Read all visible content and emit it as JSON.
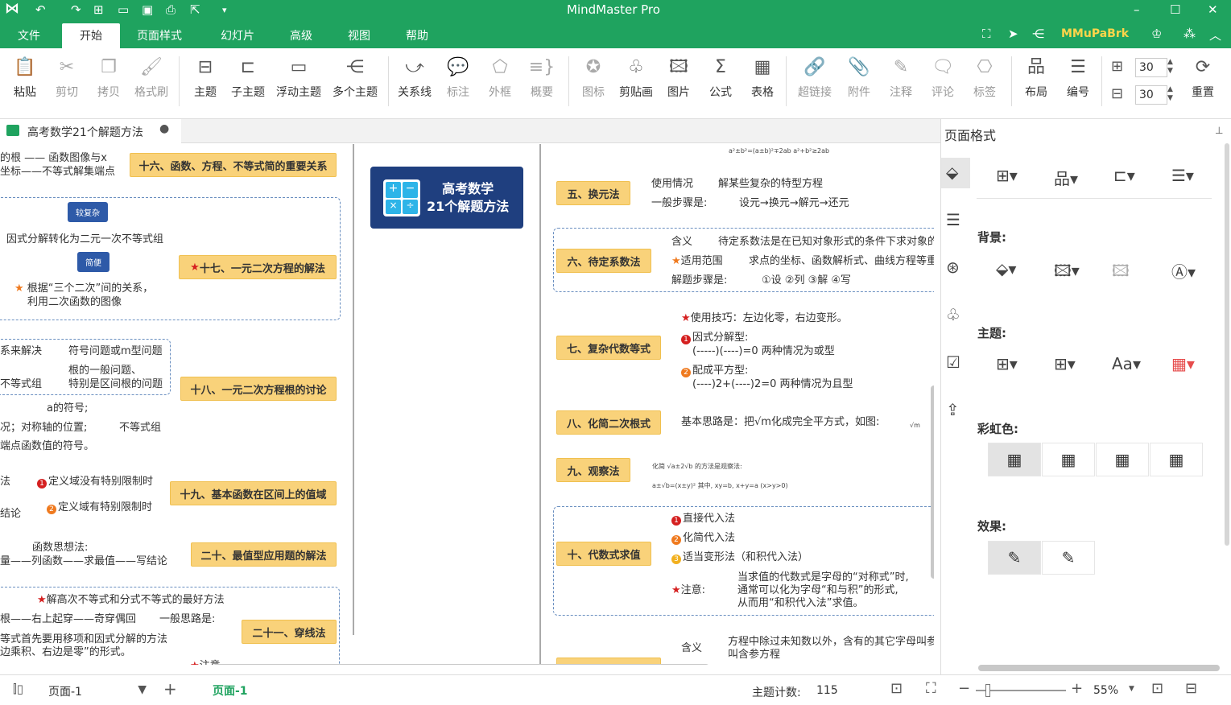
{
  "app": {
    "title": "MindMaster Pro",
    "user": "MMuPaBrk"
  },
  "menu": {
    "tabs": [
      "文件",
      "开始",
      "页面样式",
      "幻灯片",
      "高级",
      "视图",
      "帮助"
    ],
    "active": 1
  },
  "ribbon": {
    "paste": "粘贴",
    "cut": "剪切",
    "copy": "拷贝",
    "format_painter": "格式刷",
    "topic": "主题",
    "subtopic": "子主题",
    "floating_topic": "浮动主题",
    "multiple_topics": "多个主题",
    "relation": "关系线",
    "callout": "标注",
    "boundary": "外框",
    "summary": "概要",
    "icon": "图标",
    "clipart": "剪贴画",
    "image": "图片",
    "formula": "公式",
    "table": "表格",
    "hyperlink": "超链接",
    "attachment": "附件",
    "note": "注释",
    "comment": "评论",
    "tag": "标签",
    "layout": "布局",
    "numbering": "编号",
    "spacing_h": "30",
    "spacing_v": "30",
    "reset": "重置"
  },
  "doc": {
    "tab_title": "高考数学21个解题方法"
  },
  "map": {
    "central": {
      "line1": "高考数学",
      "line2": "21个解题方法"
    },
    "left": {
      "t16": {
        "title": "十六、函数、方程、不等式简的重要关系",
        "sub1": "的根 —— 函数图像与x",
        "sub2": "坐标——不等式解集端点"
      },
      "t17": {
        "title": "十七、一元二次方程的解法",
        "callout1": "较复杂",
        "sub1": "因式分解转化为二元一次不等式组",
        "callout2": "简便",
        "sub2a": "根据“三个二次”间的关系，",
        "sub2b": "利用二次函数的图像"
      },
      "t18": {
        "title": "十八、一元二次方程根的讨论",
        "s1a": "系来解决",
        "s1b": "符号问题或m型问题",
        "s2a": "不等式组",
        "s2b": "根的一般问题、",
        "s2c": "特别是区间根的问题",
        "s3a": "a的符号;",
        "s3b": "况；对称轴的位置;",
        "s3c": "端点函数值的符号。",
        "s3d": "不等式组"
      },
      "t19": {
        "title": "十九、基本函数在区间上的值域",
        "s1a": "法",
        "s1b": "定义域没有特别限制时",
        "s2a": "结论",
        "s2b": "定义域有特别限制时"
      },
      "t20": {
        "title": "二十、最值型应用题的解法",
        "s1": "函数思想法:",
        "s2": "量——列函数——求最值——写结论"
      },
      "t21": {
        "title": "二十一、穿线法",
        "s1": "解高次不等式和分式不等式的最好方法",
        "s2a": "根——右上起穿——奇穿偶回",
        "s2b": "一般思路是:",
        "s3a": "等式首先要用移项和因式分解的方法",
        "s3b": "边乘积、右边是零”的形式。",
        "s4": "注意"
      }
    },
    "right": {
      "top_tiny": "a²±b²=(a±b)²∓2ab  a²+b²≥2ab",
      "t5": {
        "title": "五、换元法",
        "s1a": "使用情况",
        "s1b": "解某些复杂的特型方程",
        "s2a": "一般步骤是:",
        "s2b": "设元→换元→解元→还元"
      },
      "t6": {
        "title": "六、待定系数法",
        "s1a": "含义",
        "s1b": "待定系数法是在已知对象形式的条件下求对象的",
        "s2a": "适用范围",
        "s2b": "求点的坐标、函数解析式、曲线方程等重",
        "s3a": "解题步骤是:",
        "s3b": "①设 ②列 ③解 ④写"
      },
      "t7": {
        "title": "七、复杂代数等式",
        "s1": "使用技巧：左边化零，右边变形。",
        "s2a": "因式分解型:",
        "s2b": "(-----)(----)=0 两种情况为或型",
        "s3a": "配成平方型:",
        "s3b": "(----)2+(----)2=0 两种情况为且型"
      },
      "t8": {
        "title": "八、化简二次根式",
        "s1": "基本思路是：把√m化成完全平方式，如图:",
        "s2": "√m"
      },
      "t9": {
        "title": "九、观察法",
        "s1": "化简 √a±2√b 的方法是观察法:",
        "s2": "a±√b=(x±y)²  其中, xy=b, x+y=a (x>y>0)"
      },
      "t10": {
        "title": "十、代数式求值",
        "s1": "直接代入法",
        "s2": "化简代入法",
        "s3": "适当变形法（和积代入法）",
        "s4a": "注意:",
        "s4b": "当求值的代数式是字母的“对称式”时,",
        "s4c": "通常可以化为字母“和与积”的形式,",
        "s4d": "从而用“和积代入法”求值。"
      },
      "t11": {
        "s1a": "含义",
        "s1b": "方程中除过未知数以外，含有的其它字母叫参",
        "s1c": "叫含参方程"
      }
    }
  },
  "panel": {
    "title": "页面格式",
    "background": "背景:",
    "theme": "主题:",
    "theme_font": "Aa",
    "rainbow": "彩虹色:",
    "effect": "效果:"
  },
  "status": {
    "page_name": "页面-1",
    "page_tab": "页面-1",
    "topic_count_label": "主题计数:",
    "topic_count": "115",
    "zoom": "55%"
  },
  "colors": {
    "brand": "#1fa35f",
    "topic": "#f9d27a",
    "central": "#1f3f7f"
  }
}
